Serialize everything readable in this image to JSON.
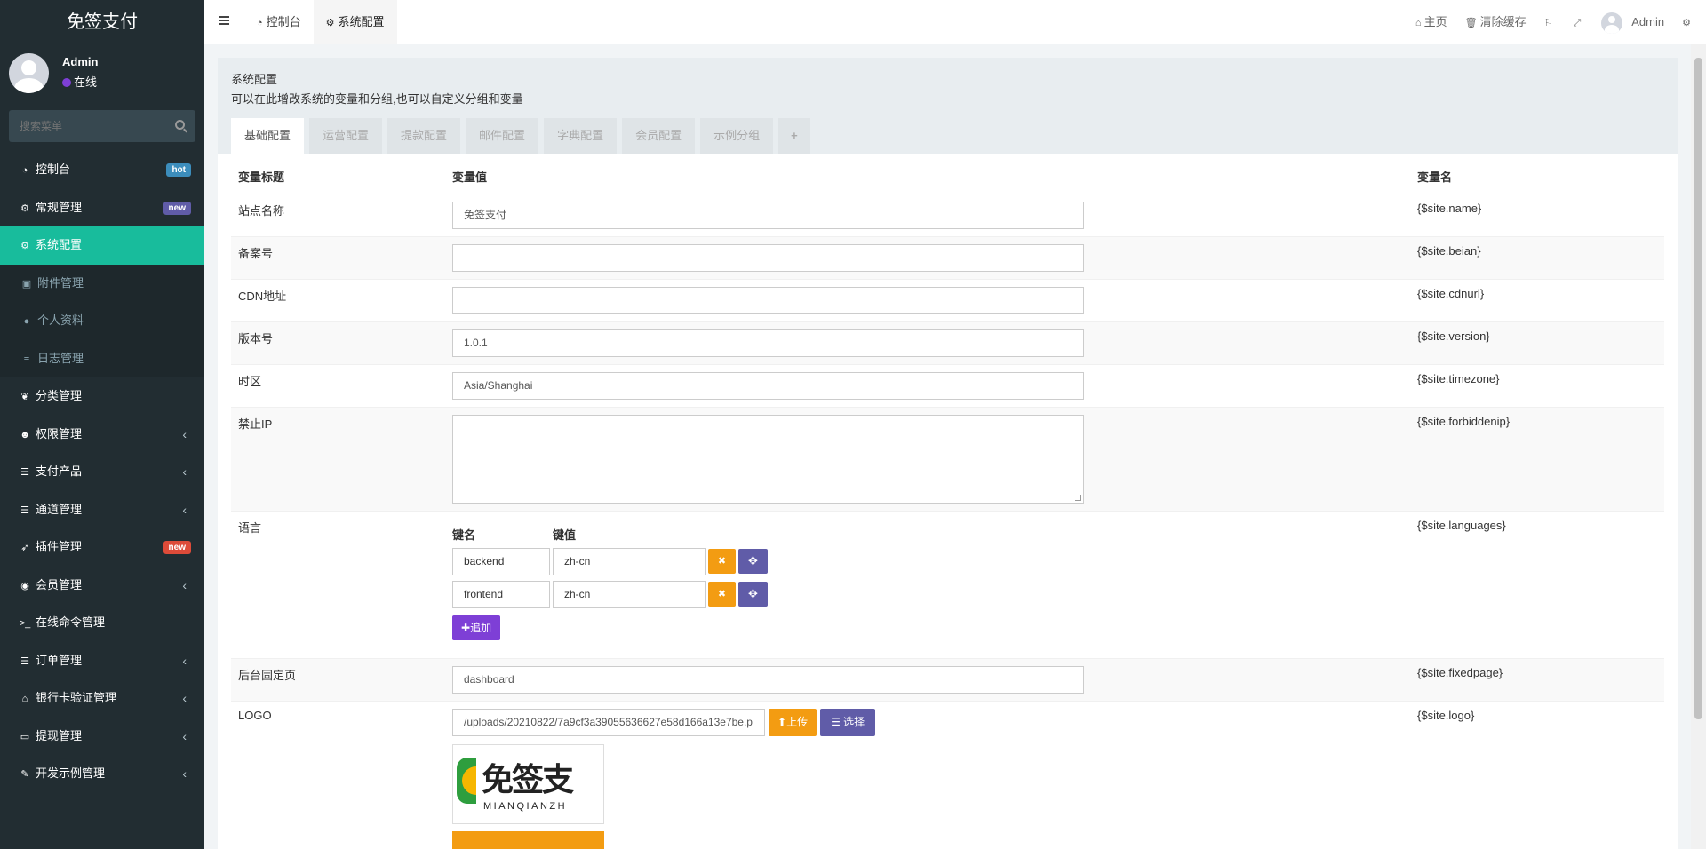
{
  "sidebar": {
    "logo": "免签支付",
    "user": {
      "name": "Admin",
      "status": "在线"
    },
    "search_placeholder": "搜索菜单",
    "items": [
      {
        "label": "控制台",
        "icon": "dashboard-icon",
        "badge": "hot"
      },
      {
        "label": "常规管理",
        "icon": "cogs-icon",
        "badge": "new"
      },
      {
        "label": "系统配置",
        "icon": "cog-icon"
      },
      {
        "label": "附件管理",
        "icon": "image-icon"
      },
      {
        "label": "个人资料",
        "icon": "user-icon"
      },
      {
        "label": "日志管理",
        "icon": "list-icon"
      },
      {
        "label": "分类管理",
        "icon": "leaf-icon"
      },
      {
        "label": "权限管理",
        "icon": "group-icon"
      },
      {
        "label": "支付产品",
        "icon": "list-icon"
      },
      {
        "label": "通道管理",
        "icon": "list-icon"
      },
      {
        "label": "插件管理",
        "icon": "rocket-icon",
        "badge": "new"
      },
      {
        "label": "会员管理",
        "icon": "user-circle-icon"
      },
      {
        "label": "在线命令管理",
        "icon": "terminal-icon"
      },
      {
        "label": "订单管理",
        "icon": "list-icon"
      },
      {
        "label": "银行卡验证管理",
        "icon": "bank-icon"
      },
      {
        "label": "提现管理",
        "icon": "visa-icon"
      },
      {
        "label": "开发示例管理",
        "icon": "magic-icon"
      }
    ]
  },
  "header": {
    "tabs": [
      {
        "label": "控制台",
        "icon": "dashboard-icon"
      },
      {
        "label": "系统配置",
        "icon": "cog-icon"
      }
    ],
    "right": {
      "home": "主页",
      "clear_cache": "清除缓存",
      "user": "Admin"
    }
  },
  "panel": {
    "title": "系统配置",
    "description": "可以在此增改系统的变量和分组,也可以自定义分组和变量",
    "tabs": [
      "基础配置",
      "运营配置",
      "提款配置",
      "邮件配置",
      "字典配置",
      "会员配置",
      "示例分组"
    ],
    "add_tab": "+"
  },
  "table": {
    "headers": {
      "title": "变量标题",
      "value": "变量值",
      "name": "变量名"
    },
    "rows": {
      "name": {
        "title": "站点名称",
        "value": "免签支付",
        "var": "{$site.name}"
      },
      "beian": {
        "title": "备案号",
        "value": "",
        "var": "{$site.beian}"
      },
      "cdnurl": {
        "title": "CDN地址",
        "value": "",
        "var": "{$site.cdnurl}"
      },
      "version": {
        "title": "版本号",
        "value": "1.0.1",
        "var": "{$site.version}"
      },
      "timezone": {
        "title": "时区",
        "value": "Asia/Shanghai",
        "var": "{$site.timezone}"
      },
      "forbiddenip": {
        "title": "禁止IP",
        "value": "",
        "var": "{$site.forbiddenip}"
      },
      "languages": {
        "title": "语言",
        "key_header": "键名",
        "value_header": "键值",
        "pairs": [
          {
            "key": "backend",
            "value": "zh-cn"
          },
          {
            "key": "frontend",
            "value": "zh-cn"
          }
        ],
        "add_label": "追加",
        "var": "{$site.languages}"
      },
      "fixedpage": {
        "title": "后台固定页",
        "value": "dashboard",
        "var": "{$site.fixedpage}"
      },
      "logo": {
        "title": "LOGO",
        "value": "/uploads/20210822/7a9cf3a39055636627e58d166a13e7be.p",
        "upload_label": "上传",
        "select_label": "选择",
        "preview_text_cn": "免签支",
        "preview_text_en": "MIANQIANZH",
        "var": "{$site.logo}"
      }
    }
  },
  "colors": {
    "sidebar_bg": "#222d32",
    "active": "#18bc9c",
    "warning": "#f39c12",
    "primary": "#605ca8",
    "purple": "#7e3fd6"
  }
}
